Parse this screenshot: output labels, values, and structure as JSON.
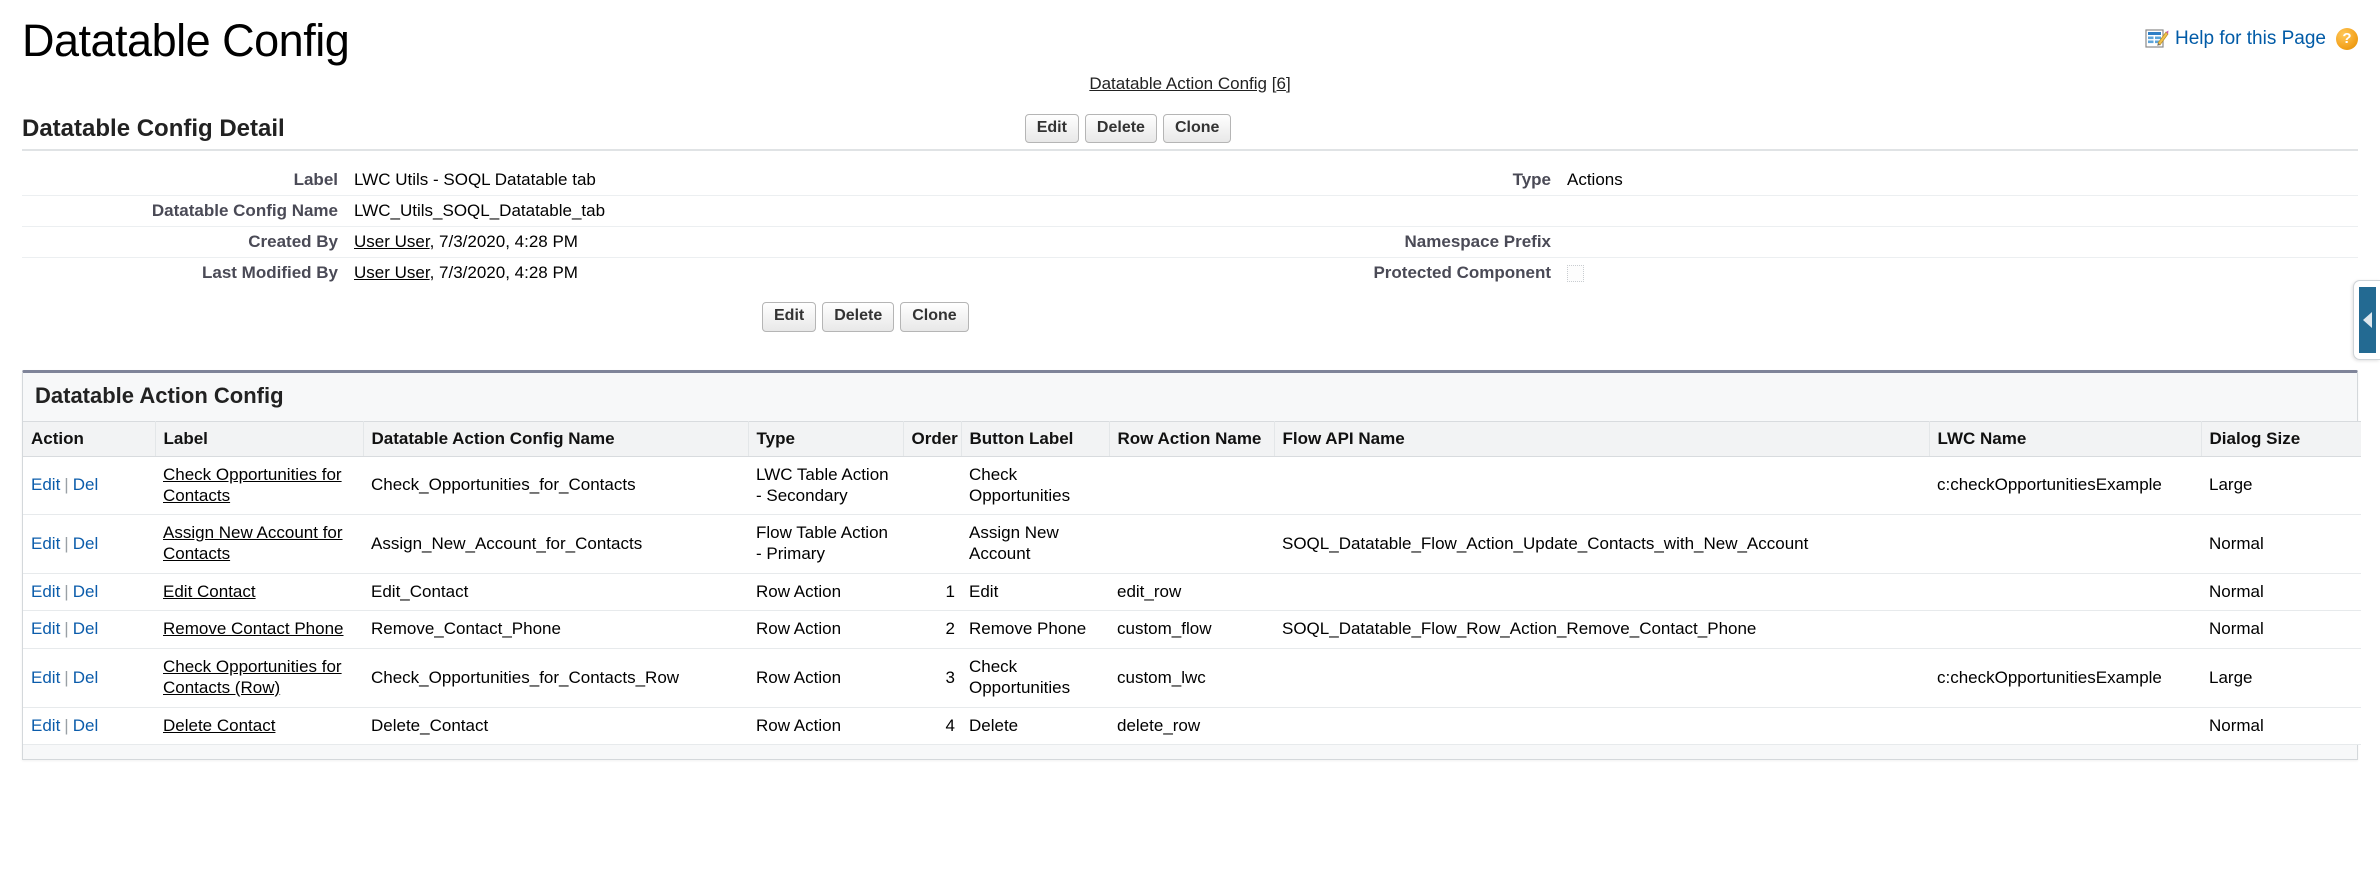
{
  "page": {
    "title": "Datatable Config",
    "help_link": "Help for this Page",
    "help_icon": "help-doc-icon",
    "question_mark": "?"
  },
  "related_links": {
    "label": "Datatable Action Config",
    "count_open": "[",
    "count": "6",
    "count_close": "]"
  },
  "detail": {
    "section_title": "Datatable Config Detail",
    "buttons": {
      "edit": "Edit",
      "delete": "Delete",
      "clone": "Clone"
    },
    "fields": {
      "label_label": "Label",
      "label_value": "LWC Utils - SOQL Datatable tab",
      "type_label": "Type",
      "type_value": "Actions",
      "config_name_label": "Datatable Config Name",
      "config_name_value": "LWC_Utils_SOQL_Datatable_tab",
      "created_by_label": "Created By",
      "created_by_user": "User User",
      "created_by_rest": ", 7/3/2020, 4:28 PM",
      "namespace_prefix_label": "Namespace Prefix",
      "namespace_prefix_value": "",
      "last_modified_by_label": "Last Modified By",
      "last_modified_by_user": "User User",
      "last_modified_by_rest": ", 7/3/2020, 4:28 PM",
      "protected_component_label": "Protected Component",
      "protected_component_checked": false
    }
  },
  "sidebar_tab": {
    "name": "collapse-sidebar-tab",
    "icon": "triangle-left-icon"
  },
  "related_list": {
    "title": "Datatable Action Config",
    "columns": [
      "Action",
      "Label",
      "Datatable Action Config Name",
      "Type",
      "Order",
      "Button Label",
      "Row Action Name",
      "Flow API Name",
      "LWC Name",
      "Dialog Size"
    ],
    "row_actions": {
      "edit": "Edit",
      "sep": "|",
      "del": "Del"
    },
    "rows": [
      {
        "label": "Check Opportunities for Contacts",
        "config_name": "Check_Opportunities_for_Contacts",
        "type": "LWC Table Action - Secondary",
        "order": "",
        "button_label": "Check Opportunities",
        "row_action_name": "",
        "flow_api_name": "",
        "lwc_name": "c:checkOpportunitiesExample",
        "dialog_size": "Large"
      },
      {
        "label": "Assign New Account for Contacts",
        "config_name": "Assign_New_Account_for_Contacts",
        "type": "Flow Table Action - Primary",
        "order": "",
        "button_label": "Assign New Account",
        "row_action_name": "",
        "flow_api_name": "SOQL_Datatable_Flow_Action_Update_Contacts_with_New_Account",
        "lwc_name": "",
        "dialog_size": "Normal"
      },
      {
        "label": "Edit Contact",
        "config_name": "Edit_Contact",
        "type": "Row Action",
        "order": "1",
        "button_label": "Edit",
        "row_action_name": "edit_row",
        "flow_api_name": "",
        "lwc_name": "",
        "dialog_size": "Normal"
      },
      {
        "label": "Remove Contact Phone",
        "config_name": "Remove_Contact_Phone",
        "type": "Row Action",
        "order": "2",
        "button_label": "Remove Phone",
        "row_action_name": "custom_flow",
        "flow_api_name": "SOQL_Datatable_Flow_Row_Action_Remove_Contact_Phone",
        "lwc_name": "",
        "dialog_size": "Normal"
      },
      {
        "label": "Check Opportunities for Contacts (Row)",
        "config_name": "Check_Opportunities_for_Contacts_Row",
        "type": "Row Action",
        "order": "3",
        "button_label": "Check Opportunities",
        "row_action_name": "custom_lwc",
        "flow_api_name": "",
        "lwc_name": "c:checkOpportunitiesExample",
        "dialog_size": "Large"
      },
      {
        "label": "Delete Contact",
        "config_name": "Delete_Contact",
        "type": "Row Action",
        "order": "4",
        "button_label": "Delete",
        "row_action_name": "delete_row",
        "flow_api_name": "",
        "lwc_name": "",
        "dialog_size": "Normal"
      }
    ]
  },
  "colors": {
    "link_blue": "#0b5cab",
    "header_bar": "#7f8499",
    "sidebar_tab": "#236a92",
    "label_gray": "#4a4a56"
  }
}
